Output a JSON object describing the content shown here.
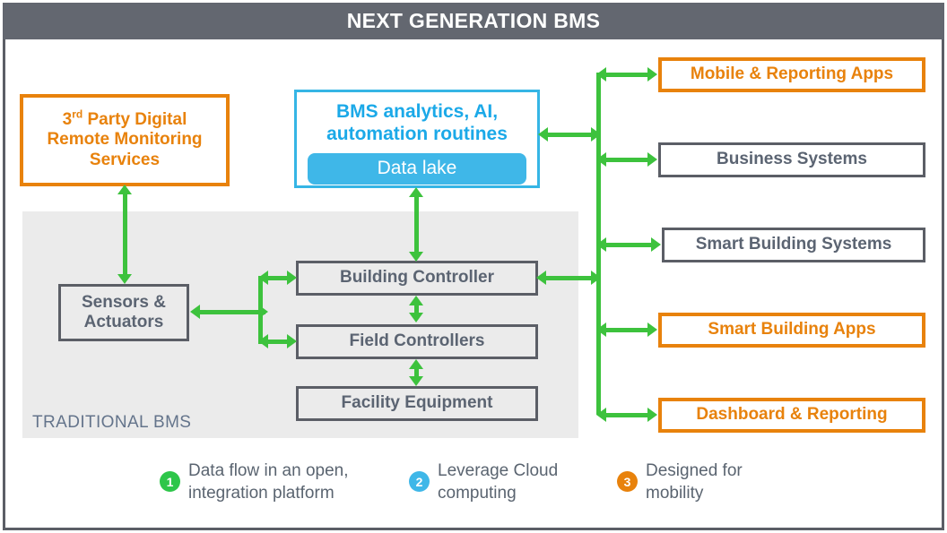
{
  "header": {
    "title": "NEXT GENERATION BMS",
    "background": "#636770",
    "text_color": "#ffffff"
  },
  "colors": {
    "orange": "#e8820c",
    "blue": "#35b5e5",
    "green": "#3dc23d",
    "gray": "#5b5e66",
    "panel_gray": "#ebebeb",
    "legend_text": "#5a6470"
  },
  "panel": {
    "label": "TRADITIONAL BMS"
  },
  "nodes": {
    "third_party": {
      "line1_pre": "3",
      "line1_sup": "rd",
      "line1_post": " Party Digital",
      "line2": "Remote Monitoring",
      "line3": "Services",
      "style": "orange"
    },
    "analytics": {
      "title": "BMS analytics, AI,\nautomation routines",
      "data_lake": "Data lake",
      "style": "blue"
    },
    "sensors": {
      "label": "Sensors &\nActuators",
      "style": "gray"
    },
    "building_controller": {
      "label": "Building Controller",
      "style": "gray"
    },
    "field_controllers": {
      "label": "Field Controllers",
      "style": "gray"
    },
    "facility_equipment": {
      "label": "Facility Equipment",
      "style": "gray"
    },
    "mobile_apps": {
      "label": "Mobile & Reporting Apps",
      "style": "orange"
    },
    "business_systems": {
      "label": "Business Systems",
      "style": "gray"
    },
    "smart_building_systems": {
      "label": "Smart Building Systems",
      "style": "gray"
    },
    "smart_building_apps": {
      "label": "Smart Building Apps",
      "style": "orange"
    },
    "dashboard_reporting": {
      "label": "Dashboard & Reporting",
      "style": "orange"
    }
  },
  "legend": [
    {
      "number": "1",
      "color": "#2ec64a",
      "text": "Data flow in an open,\nintegration platform"
    },
    {
      "number": "2",
      "color": "#3fb7e8",
      "text": "Leverage Cloud\ncomputing"
    },
    {
      "number": "3",
      "color": "#e8820c",
      "text": "Designed for\nmobility"
    }
  ]
}
